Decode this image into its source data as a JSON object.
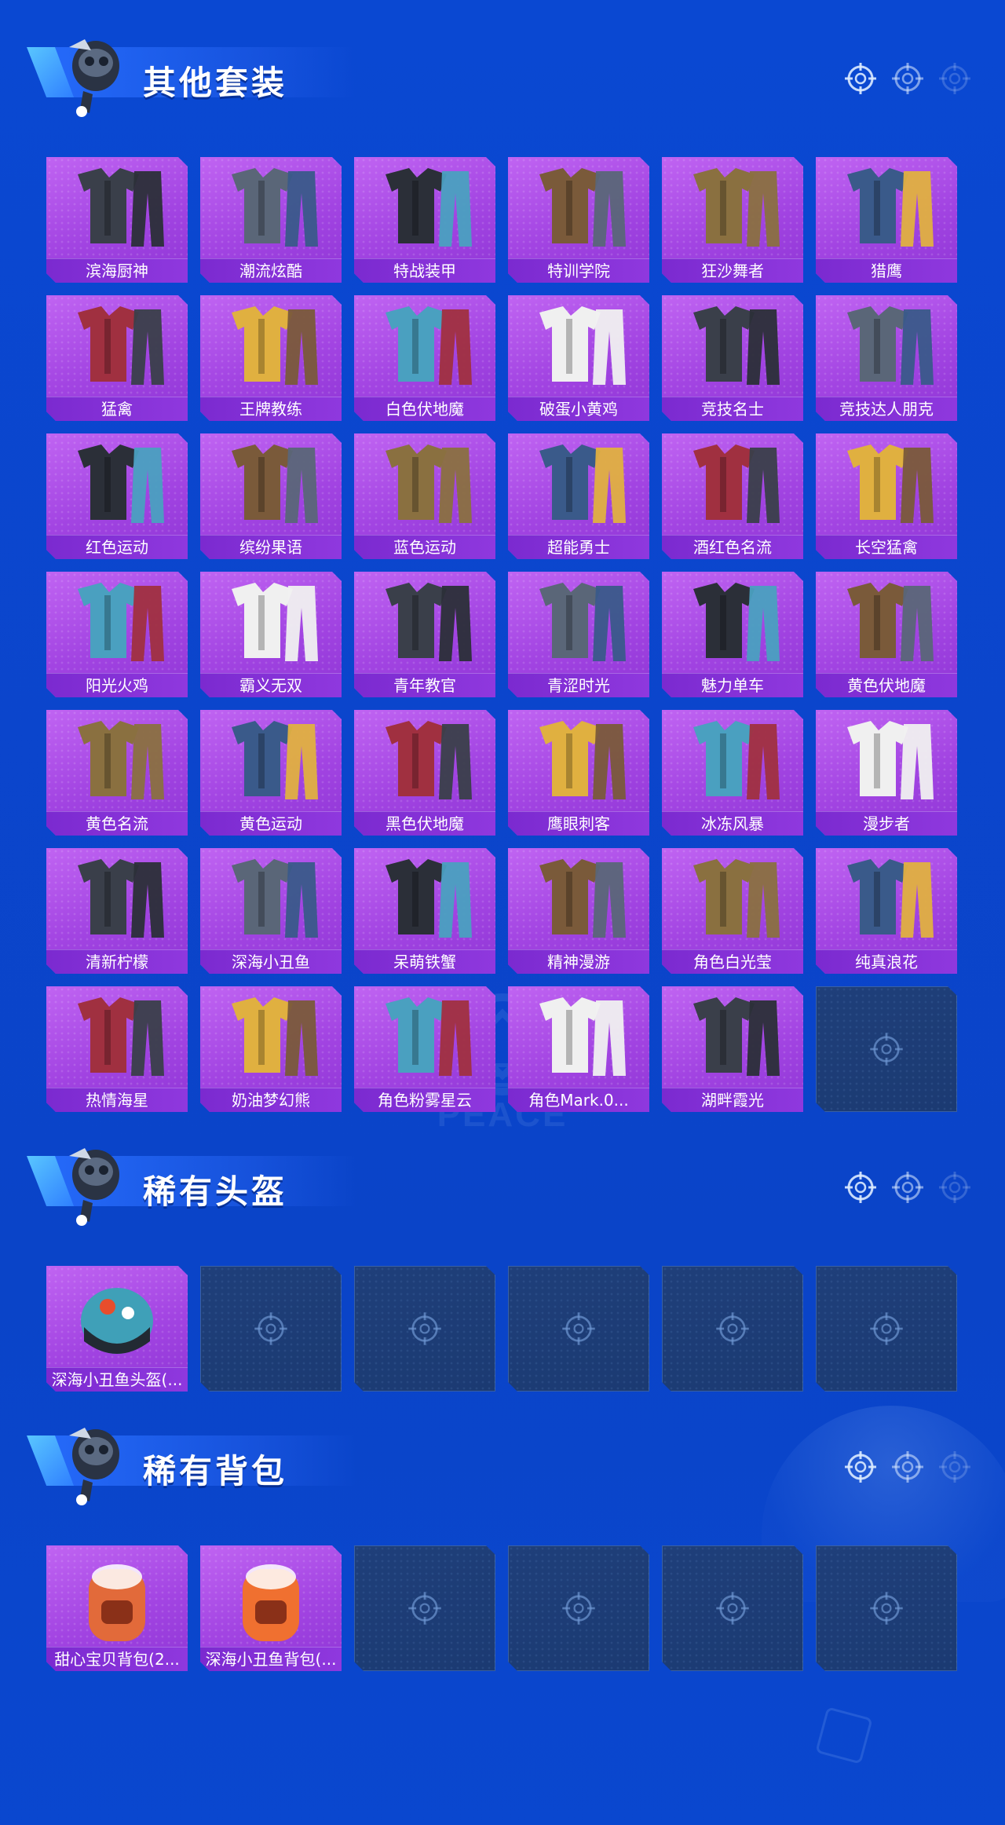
{
  "sections": [
    {
      "title": "其他套装",
      "items": [
        "滨海厨神",
        "潮流炫酷",
        "特战装甲",
        "特训学院",
        "狂沙舞者",
        "猎鹰",
        "猛禽",
        "王牌教练",
        "白色伏地魔",
        "破蛋小黄鸡",
        "竞技名士",
        "竞技达人朋克",
        "红色运动",
        "缤纷果语",
        "蓝色运动",
        "超能勇士",
        "酒红色名流",
        "长空猛禽",
        "阳光火鸡",
        "霸义无双",
        "青年教官",
        "青涩时光",
        "魅力单车",
        "黄色伏地魔",
        "黄色名流",
        "黄色运动",
        "黑色伏地魔",
        "鹰眼刺客",
        "冰冻风暴",
        "漫步者",
        "清新柠檬",
        "深海小丑鱼",
        "呆萌铁蟹",
        "精神漫游",
        "角色白光莹",
        "纯真浪花",
        "热情海星",
        "奶油梦幻熊",
        "角色粉雾星云",
        "角色Mark.0...",
        "湖畔霞光"
      ],
      "empty_slots": 1
    },
    {
      "title": "稀有头盔",
      "items": [
        "深海小丑鱼头盔(..."
      ],
      "empty_slots": 5
    },
    {
      "title": "稀有背包",
      "items": [
        "甜心宝贝背包(2...",
        "深海小丑鱼背包(..."
      ],
      "empty_slots": 4
    }
  ],
  "watermark": "GAME FOR PEACE",
  "colors": {
    "background": "#0a48d2",
    "card_purple": "#a244e2",
    "label_purple": "#7b2ad0",
    "empty_slot": "#1f3f7a"
  }
}
